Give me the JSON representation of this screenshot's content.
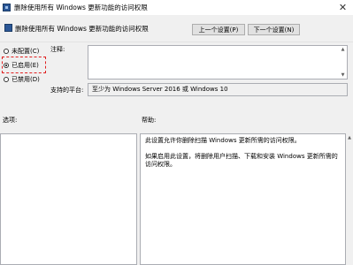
{
  "window": {
    "title": "删除使用所有 Windows 更新功能的访问权限",
    "close_glyph": "✕"
  },
  "header": {
    "policy_name": "删除使用所有 Windows 更新功能的访问权限",
    "prev_button": "上一个设置(P)",
    "next_button": "下一个设置(N)"
  },
  "state": {
    "options": [
      {
        "label": "未配置(C)",
        "checked": false
      },
      {
        "label": "已启用(E)",
        "checked": true
      },
      {
        "label": "已禁用(D)",
        "checked": false
      }
    ]
  },
  "comment": {
    "label": "注释:",
    "value": ""
  },
  "platform": {
    "label": "支持的平台:",
    "value": "至少为 Windows Server 2016 或 Windows 10"
  },
  "options_section": {
    "label": "选项:"
  },
  "help_section": {
    "label": "帮助:",
    "paragraphs": [
      "此设置允许你删除扫描 Windows 更新所需的访问权限。",
      "如果启用此设置，将删除用户扫描、下载和安装 Windows 更新所需的访问权限。"
    ]
  },
  "icons": {
    "app": "group-policy-icon",
    "close": "close-icon"
  }
}
